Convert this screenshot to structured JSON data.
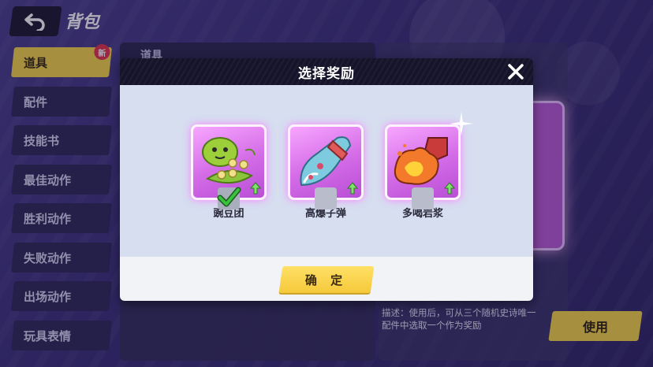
{
  "header": {
    "title": "背包",
    "back_icon": "back-arrow-icon"
  },
  "sidebar": {
    "items": [
      {
        "label": "道具",
        "active": true,
        "badge": "新"
      },
      {
        "label": "配件"
      },
      {
        "label": "技能书"
      },
      {
        "label": "最佳动作"
      },
      {
        "label": "胜利动作"
      },
      {
        "label": "失败动作"
      },
      {
        "label": "出场动作"
      },
      {
        "label": "玩具表情"
      }
    ]
  },
  "panel": {
    "header": "道具"
  },
  "detail": {
    "description": "描述：使用后，可从三个随机史诗唯一配件中选取一个作为奖励",
    "use_label": "使用"
  },
  "modal": {
    "title": "选择奖励",
    "confirm_label": "确 定",
    "rewards": [
      {
        "name": "豌豆团",
        "icon": "pea-pod-icon",
        "checked": true
      },
      {
        "name": "高爆子弹",
        "icon": "bullet-icon",
        "checked": false
      },
      {
        "name": "多喝岩浆",
        "icon": "lava-icon",
        "checked": false
      }
    ]
  },
  "colors": {
    "accent_yellow": "#f5d64a",
    "card_purple": "#d36ae6",
    "check_green": "#38c23d"
  }
}
